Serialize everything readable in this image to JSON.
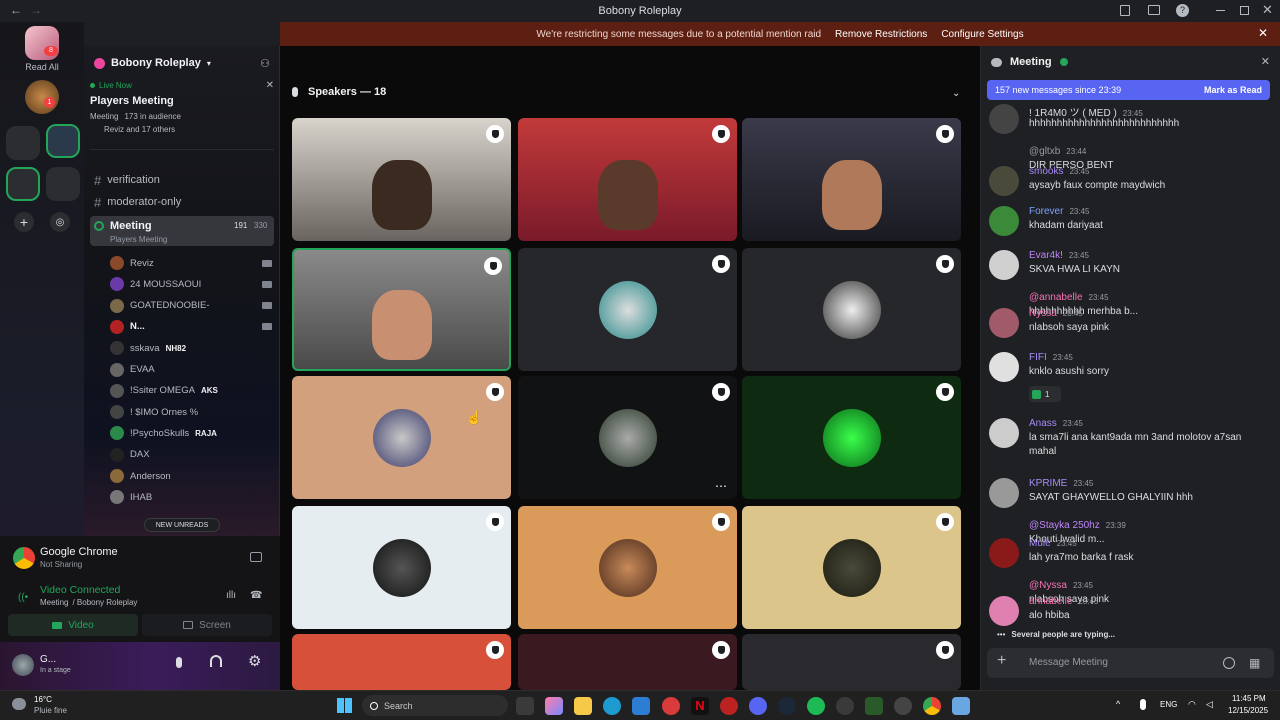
{
  "window": {
    "title": "Bobony Roleplay"
  },
  "banner": {
    "text": "We're restricting some messages due to a potential mention raid",
    "remove": "Remove Restrictions",
    "configure": "Configure Settings"
  },
  "guilds": {
    "read_all": "Read All"
  },
  "server": {
    "name": "Bobony Roleplay",
    "live_label": "Live Now",
    "event_title": "Players Meeting",
    "event_sub": "Meeting",
    "audience": "173 in audience",
    "audience_names": "Reviz and 17 others",
    "channels": [
      "verification",
      "moderator-only"
    ],
    "voice_channel": "Meeting",
    "voice_sub": "Players Meeting",
    "voice_count_a": "191",
    "voice_count_b": "330",
    "members": [
      "Reviz",
      "24 MOUSSAOUI",
      "GOATEDNOOBIE-",
      "N...",
      "sskava",
      "EVAA",
      "!Ssiter OMEGA",
      "! $IMO Ornes %",
      "!PsychoSkulls",
      "DAX",
      "Anderson",
      "IHAB"
    ],
    "member_tags": {
      "sskava": "NH82",
      "omega": "AKS",
      "psycho": "RAJA"
    },
    "new_unreads": "NEW UNREADS"
  },
  "voicepanel": {
    "app": "Google Chrome",
    "app_status": "Not Sharing",
    "connected": "Video Connected",
    "connected_sub": "Meeting",
    "connected_server": "/ Bobony Roleplay",
    "video_btn": "Video",
    "screen_btn": "Screen",
    "user": "G...",
    "user_status": "In a stage"
  },
  "stage": {
    "speakers": "Speakers — 18"
  },
  "chat": {
    "title": "Meeting",
    "new_messages": "157 new messages since 23:39",
    "mark_read": "Mark as Read",
    "input_placeholder": "Message Meeting",
    "typing": "Several people are typing...",
    "messages": [
      {
        "name": "! 1R4M0 ツ ( MED )",
        "time": "23:45",
        "text": "hhhhhhhhhhhhhhhhhhhhhhhhhhh",
        "color": "#dbdee1"
      },
      {
        "name": "@gltxb",
        "time": "23:44",
        "text": "DIR PERSO BENT",
        "color": "#949ba4"
      },
      {
        "name": "smooks",
        "time": "23:45",
        "text": "aysayb faux compte maydwich",
        "color": "#a78bfa"
      },
      {
        "name": "Forever",
        "time": "23:45",
        "text": "khadam dariyaat",
        "color": "#7aa2ff"
      },
      {
        "name": "Evar4k!",
        "time": "23:45",
        "text": "SKVA HWA LI KAYN",
        "color": "#c084fc"
      },
      {
        "name": "@annabelle",
        "time": "23:45",
        "text": "hhhhhhhhhh merhba b...",
        "color": "#f472b6"
      },
      {
        "name": "Nyssa",
        "time": "23:45",
        "text": "nlabsoh saya pink",
        "color": "#f472b6"
      },
      {
        "name": "FIFI",
        "time": "23:45",
        "text": "knklo asushi sorry",
        "color": "#a78bfa"
      },
      {
        "name": "Anass",
        "time": "23:45",
        "text": "la sma7li ana kant9ada mn 3and molotov a7san",
        "text2": "mahal",
        "color": "#a78bfa"
      },
      {
        "name": "KPRIME",
        "time": "23:45",
        "text": "SAYAT GHAYWELLO GHALYIIN hhh",
        "color": "#a78bfa"
      },
      {
        "name": "@Stayka 250hz",
        "time": "23:39",
        "text": "Khouti lwalid m...",
        "color": "#c084fc"
      },
      {
        "name": "Mule",
        "time": "23:45",
        "text": "lah yra7mo barka f rask",
        "color": "#a78bfa"
      },
      {
        "name": "@Nyssa",
        "time": "23:45",
        "text": "nlabsoh saya pink",
        "color": "#f472b6"
      },
      {
        "name": "annabelle",
        "time": "23:45",
        "text": "alo hbiba",
        "color": "#f472b6"
      }
    ],
    "reaction_count": "1"
  },
  "taskbar": {
    "weather_temp": "16°C",
    "weather_text": "Pluie fine",
    "search": "Search",
    "lang": "ENG",
    "time": "11:45 PM",
    "date": "12/15/2025"
  },
  "colors": {
    "accent": "#5865f2",
    "banner": "#5c1f12",
    "live": "#23a55a"
  }
}
